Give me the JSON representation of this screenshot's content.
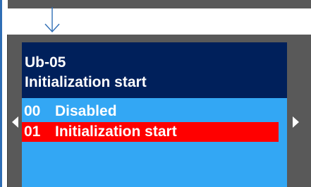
{
  "screen": {
    "parameter_code": "Ub-05",
    "parameter_title": "Initialization start"
  },
  "options": [
    {
      "number": "00",
      "label": "Disabled",
      "selected": false
    },
    {
      "number": "01",
      "label": "Initialization  start",
      "selected": true
    }
  ],
  "icons": {
    "flow": "down-arrow-icon",
    "prev": "left-triangle-icon",
    "next": "right-triangle-icon"
  },
  "colors": {
    "header_bg": "#00205b",
    "list_bg": "#33a7f4",
    "selection": "#ff0000",
    "bezel": "#595959",
    "flow_arrow": "#2f6eb5"
  }
}
